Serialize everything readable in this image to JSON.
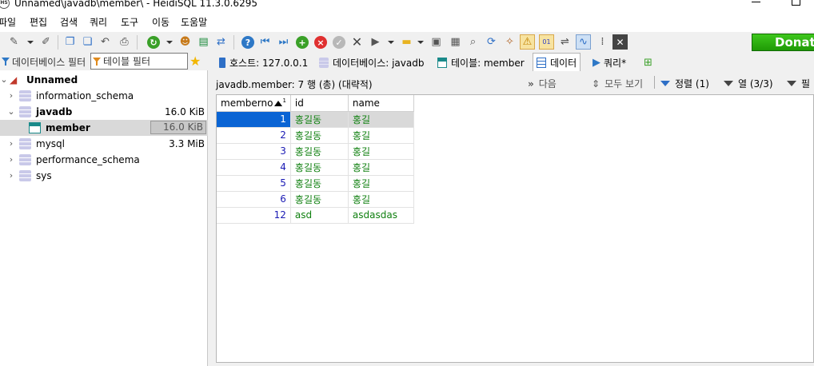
{
  "window": {
    "title": "Unnamed\\javadb\\member\\ - HeidiSQL 11.3.0.6295",
    "app_icon_text": "HS"
  },
  "menu": [
    "파일",
    "편집",
    "검색",
    "쿼리",
    "도구",
    "이동",
    "도움말"
  ],
  "toolbar": {
    "donate_label": "Donat",
    "icons": [
      "connect-icon",
      "disconnect-icon",
      "copy-icon",
      "paste-icon",
      "undo-icon",
      "print-icon",
      "refresh-icon",
      "user-manager-icon",
      "export-icon",
      "transfer-icon",
      "help-icon",
      "first-icon",
      "last-icon",
      "add-icon",
      "delete-icon",
      "post-icon",
      "cancel-icon",
      "run-icon",
      "open-folder-icon",
      "save-icon",
      "load-icon",
      "find-icon",
      "replace-icon",
      "clean-icon",
      "warning-icon",
      "binary-icon",
      "wrap-icon",
      "sync-icon",
      "columns-icon",
      "close-icon"
    ]
  },
  "left_pane": {
    "filter_db_label": "데이터베이스 필터",
    "filter_table_label": "테이블 필터",
    "tree": [
      {
        "label": "Unnamed",
        "size": "",
        "level": 0
      },
      {
        "label": "information_schema",
        "size": "",
        "level": 1
      },
      {
        "label": "javadb",
        "size": "16.0 KiB",
        "level": 1
      },
      {
        "label": "member",
        "size": "16.0 KiB",
        "level": 2
      },
      {
        "label": "mysql",
        "size": "3.3 MiB",
        "level": 1
      },
      {
        "label": "performance_schema",
        "size": "",
        "level": 1
      },
      {
        "label": "sys",
        "size": "",
        "level": 1
      }
    ]
  },
  "tabs": [
    {
      "label": "호스트: 127.0.0.1"
    },
    {
      "label": "데이터베이스: javadb"
    },
    {
      "label": "테이블: member"
    },
    {
      "label": "데이터"
    },
    {
      "label": "쿼리*"
    }
  ],
  "info_bar": {
    "text": "javadb.member: 7 행 (총) (대략적)",
    "next_label": "다음",
    "show_all_label": "모두 보기",
    "sort_label": "정렬 (1)",
    "columns_label": "열 (3/3)",
    "filter_label": "필"
  },
  "grid": {
    "columns": [
      "memberno",
      "id",
      "name"
    ],
    "sort_indicator": "1",
    "rows": [
      [
        "1",
        "홍길동",
        "홍길"
      ],
      [
        "2",
        "홍길동",
        "홍길"
      ],
      [
        "3",
        "홍길동",
        "홍길"
      ],
      [
        "4",
        "홍길동",
        "홍길"
      ],
      [
        "5",
        "홍길동",
        "홍길"
      ],
      [
        "6",
        "홍길동",
        "홍길"
      ],
      [
        "12",
        "asd",
        "asdasdas"
      ]
    ]
  }
}
